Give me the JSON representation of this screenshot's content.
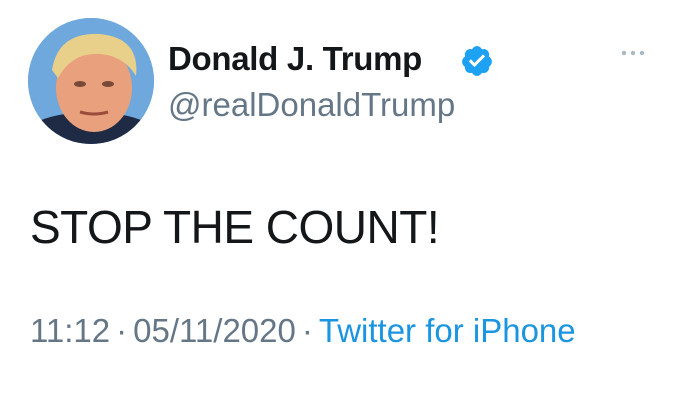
{
  "author": {
    "display_name": "Donald J. Trump",
    "handle": "@realDonaldTrump",
    "verified": true,
    "verified_color": "#1da1f2"
  },
  "icons": {
    "avatar": "profile-photo",
    "verified": "verified-badge-icon",
    "more": "more-options-icon"
  },
  "tweet": {
    "text": "STOP THE COUNT!"
  },
  "meta": {
    "time": "11:12",
    "separator": "·",
    "date": "05/11/2020",
    "source": "Twitter for iPhone",
    "text_color": "#657786",
    "link_color": "#1b95e0"
  }
}
